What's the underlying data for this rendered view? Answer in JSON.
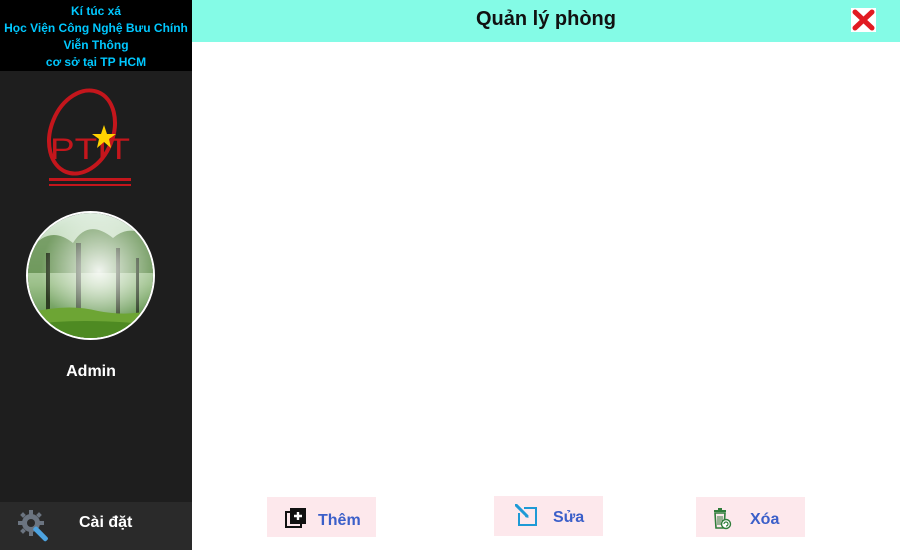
{
  "sidebar": {
    "org_lines": [
      "Kí túc xá",
      "Học Viện Công Nghệ Bưu Chính",
      "Viễn Thông",
      "cơ sở tại TP HCM"
    ],
    "logo_text": "PTIT",
    "username": "Admin",
    "settings_label": "Cài đặt",
    "settings_icon": "gear-wrench-icon"
  },
  "header": {
    "title": "Quản lý phòng",
    "close_icon": "close-x-icon"
  },
  "actions": {
    "add_label": "Thêm",
    "add_icon": "add-library-icon",
    "edit_label": "Sửa",
    "edit_icon": "edit-pen-icon",
    "delete_label": "Xóa",
    "delete_icon": "recycle-bin-icon"
  },
  "colors": {
    "header_bg": "#84fbe6",
    "sidebar_bg": "#1e1e1e",
    "org_text": "#00c8ff",
    "button_bg": "#fde8ec",
    "button_text": "#3b5fc9",
    "logo_red": "#c4161c",
    "close_red": "#e11b22"
  }
}
